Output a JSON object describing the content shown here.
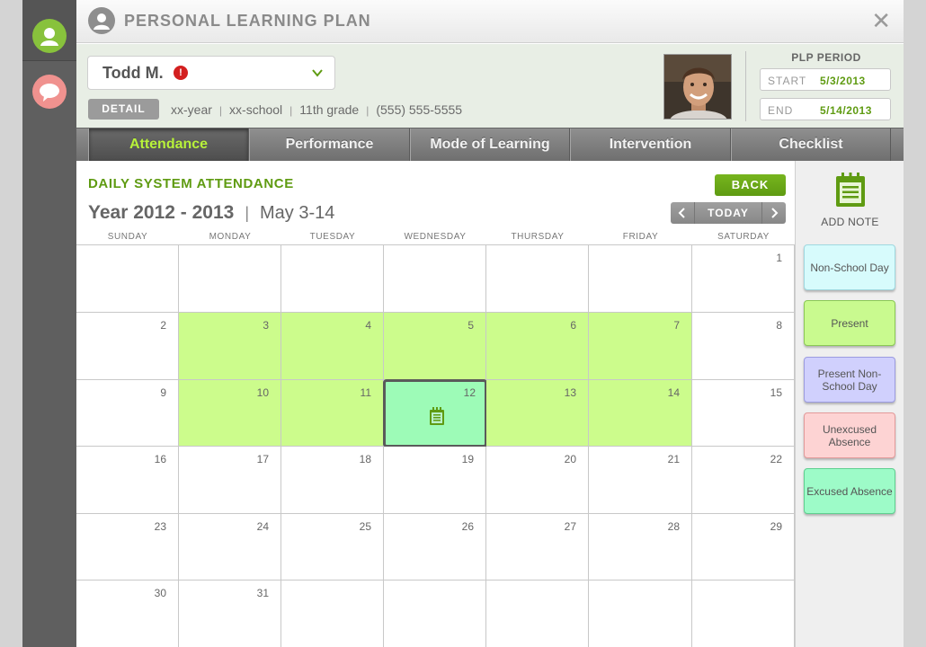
{
  "header": {
    "title": "PERSONAL LEARNING PLAN",
    "close_label": "✕"
  },
  "student": {
    "name": "Todd M.",
    "alert": "!",
    "detail_label": "DETAIL",
    "year": "xx-year",
    "school": "xx-school",
    "grade": "11th grade",
    "phone": "(555) 555-5555"
  },
  "plp": {
    "label": "PLP PERIOD",
    "start_label": "START",
    "start_value": "5/3/2013",
    "end_label": "END",
    "end_value": "5/14/2013"
  },
  "tabs": [
    "Attendance",
    "Performance",
    "Mode of Learning",
    "Intervention",
    "Checklist"
  ],
  "active_tab": "Attendance",
  "content": {
    "title": "DAILY SYSTEM ATTENDANCE",
    "year": "Year 2012 - 2013",
    "range": "May 3-14",
    "back_label": "BACK",
    "today_label": "TODAY"
  },
  "weekdays": [
    "SUNDAY",
    "MONDAY",
    "TUESDAY",
    "WEDNESDAY",
    "THURSDAY",
    "FRIDAY",
    "SATURDAY"
  ],
  "calendar": {
    "weeks": [
      [
        null,
        null,
        null,
        null,
        null,
        null,
        1
      ],
      [
        2,
        3,
        4,
        5,
        6,
        7,
        8
      ],
      [
        9,
        10,
        11,
        12,
        13,
        14,
        15
      ],
      [
        16,
        17,
        18,
        19,
        20,
        21,
        22
      ],
      [
        23,
        24,
        25,
        26,
        27,
        28,
        29
      ],
      [
        30,
        31,
        null,
        null,
        null,
        null,
        null
      ]
    ],
    "present_days": [
      3,
      4,
      5,
      6,
      7,
      10,
      11,
      13,
      14
    ],
    "excused_days": [
      12
    ],
    "note_days": [
      12
    ]
  },
  "sidebar": {
    "add_note_label": "ADD NOTE",
    "legend": {
      "non_school_day": "Non-School Day",
      "present": "Present",
      "present_non_school_day": "Present Non-School Day",
      "unexcused_absence": "Unexcused Absence",
      "excused_absence": "Excused Absence"
    }
  },
  "colors": {
    "accent_green": "#5f9b12",
    "active_tab_text": "#b8f23a",
    "present": "#ccfc8c",
    "excused": "#9dfbb7",
    "non_school_day": "#d7fbfc",
    "present_non_school_day": "#d0d0fd",
    "unexcused": "#fdd3d3"
  },
  "icons": {
    "rail_user": "user-icon",
    "rail_chat": "chat-icon",
    "note": "notepad-icon"
  }
}
